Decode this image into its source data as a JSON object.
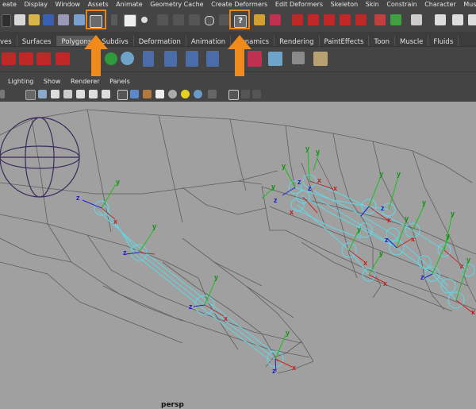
{
  "menubar": {
    "items": [
      "eate",
      "Display",
      "Window",
      "Assets",
      "Animate",
      "Geometry Cache",
      "Create Deformers",
      "Edit Deformers",
      "Skeleton",
      "Skin",
      "Constrain",
      "Character",
      "Muscle"
    ]
  },
  "shelf_tabs": [
    "ves",
    "Surfaces",
    "Polygons",
    "Subdivs",
    "Deformation",
    "Animation",
    "Dynamics",
    "Rendering",
    "PaintEffects",
    "Toon",
    "Muscle",
    "Fluids"
  ],
  "shelf_active_tab": "Polygons",
  "panel_menu": [
    "Lighting",
    "Show",
    "Renderer",
    "Panels"
  ],
  "viewport": {
    "camera_label": "persp",
    "axis_x": "x",
    "axis_y": "y",
    "axis_z": "z"
  },
  "colors": {
    "highlight": "#e8861a",
    "viewport_bg": "#a0a0a0",
    "joint": "#6fe0ee",
    "mesh": "#5b5b5b"
  },
  "icons": {
    "help": "question-icon",
    "snap": "snap-grid-icon"
  }
}
